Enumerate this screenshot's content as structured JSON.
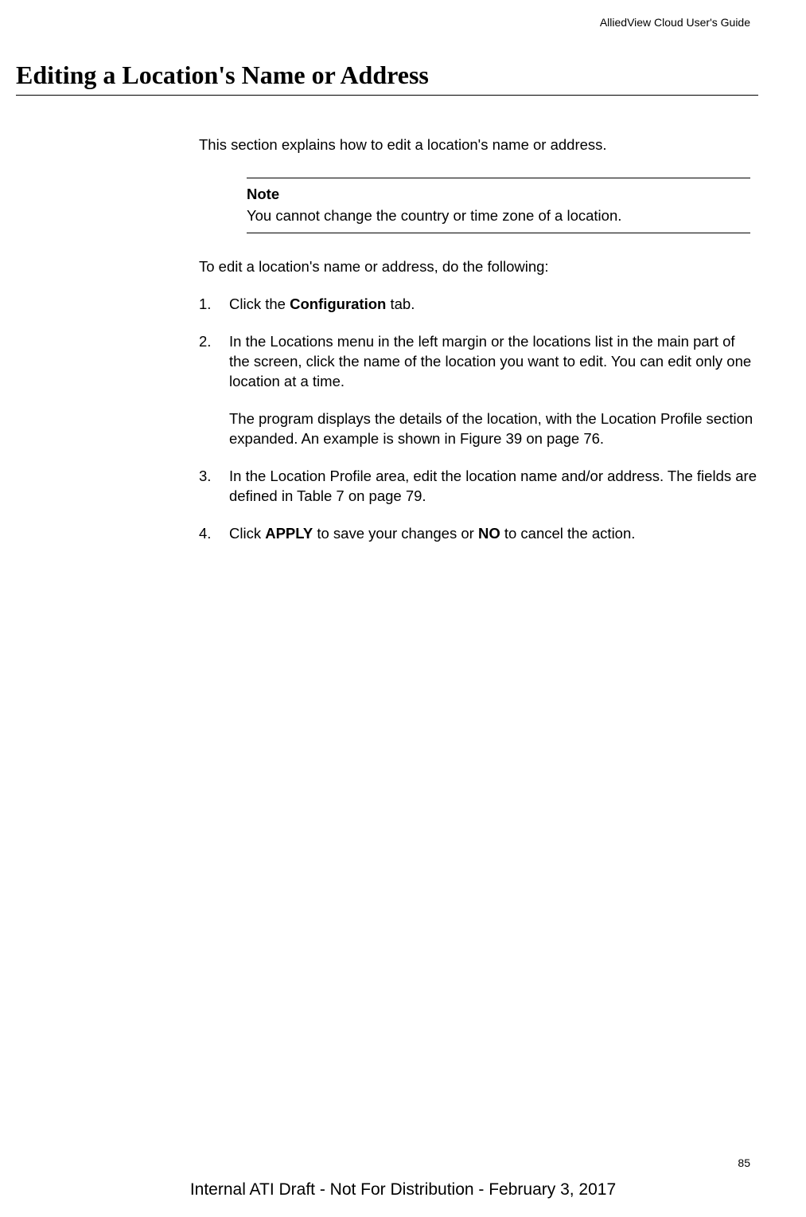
{
  "header": {
    "running_title": "AlliedView Cloud User's Guide"
  },
  "section": {
    "title": "Editing a Location's Name or Address",
    "intro": "This section explains how to edit a location's name or address.",
    "note": {
      "label": "Note",
      "text": "You cannot change the country or time zone of a location."
    },
    "instruction": "To edit a location's name or address, do the following:",
    "steps": {
      "s1_num": "1.",
      "s1_a": "Click the ",
      "s1_b": "Configuration",
      "s1_c": " tab.",
      "s2_num": "2.",
      "s2_a": "In the Locations menu in the left margin or the locations list in the main part of the screen, click the name of the location you want to edit. You can edit only one location at a time.",
      "s2_b": "The program displays the details of the location, with the Location Profile section expanded. An example is shown in Figure 39 on page 76.",
      "s3_num": "3.",
      "s3_a": "In the Location Profile area, edit the location name and/or address. The fields are defined in Table 7 on page 79.",
      "s4_num": "4.",
      "s4_a": "Click ",
      "s4_b": "APPLY",
      "s4_c": " to save your changes or ",
      "s4_d": "NO",
      "s4_e": " to cancel the action."
    }
  },
  "page_number": "85",
  "footer": "Internal ATI Draft - Not For Distribution - February 3, 2017"
}
